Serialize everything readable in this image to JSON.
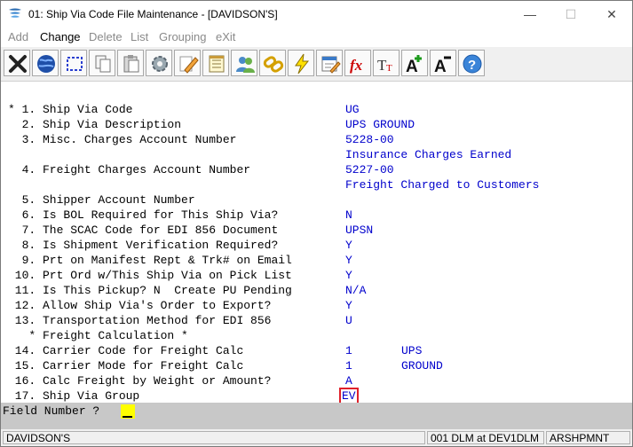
{
  "window": {
    "title": "01: Ship Via Code File Maintenance - [DAVIDSON'S]",
    "minimize": "—",
    "maximize": "☐",
    "close": "✕"
  },
  "menu": [
    {
      "label": "Add",
      "name": "menu-add",
      "active": false
    },
    {
      "label": "Change",
      "name": "menu-change",
      "active": true
    },
    {
      "label": "Delete",
      "name": "menu-delete",
      "active": false
    },
    {
      "label": "List",
      "name": "menu-list",
      "active": false
    },
    {
      "label": "Grouping",
      "name": "menu-grouping",
      "active": false
    },
    {
      "label": "eXit",
      "name": "menu-exit",
      "active": false
    }
  ],
  "toolbar": [
    "close-x-icon",
    "globe-icon",
    "select-rectangle-icon",
    "copy-icon",
    "paste-icon",
    "settings-gear-icon",
    "edit-pencil-icon",
    "notepad-icon",
    "users-icon",
    "chain-link-icon",
    "lightning-icon",
    "calendar-edit-icon",
    "function-fx-icon",
    "font-size-icon",
    "font-increase-icon",
    "font-decrease-icon",
    "help-icon"
  ],
  "fields": [
    {
      "label": "* 1. Ship Via Code",
      "values": [
        {
          "text": "UG"
        }
      ]
    },
    {
      "label": "  2. Ship Via Description",
      "values": [
        {
          "text": "UPS GROUND"
        }
      ]
    },
    {
      "label": "  3. Misc. Charges Account Number",
      "values": [
        {
          "text": "5228-00"
        }
      ]
    },
    {
      "label": "",
      "values": [
        {
          "text": "Insurance Charges Earned"
        }
      ]
    },
    {
      "label": "  4. Freight Charges Account Number",
      "values": [
        {
          "text": "5227-00"
        }
      ]
    },
    {
      "label": "",
      "values": [
        {
          "text": "Freight Charged to Customers"
        }
      ]
    },
    {
      "label": "  5. Shipper Account Number",
      "values": []
    },
    {
      "label": "  6. Is BOL Required for This Ship Via?",
      "values": [
        {
          "text": "N"
        }
      ]
    },
    {
      "label": "  7. The SCAC Code for EDI 856 Document",
      "values": [
        {
          "text": "UPSN"
        }
      ]
    },
    {
      "label": "  8. Is Shipment Verification Required?",
      "values": [
        {
          "text": "Y"
        }
      ]
    },
    {
      "label": "  9. Prt on Manifest Rept & Trk# on Email",
      "values": [
        {
          "text": "Y"
        }
      ]
    },
    {
      "label": " 10. Prt Ord w/This Ship Via on Pick List",
      "values": [
        {
          "text": "Y"
        }
      ]
    },
    {
      "label": " 11. Is This Pickup? N  Create PU Pending",
      "values": [
        {
          "text": "N/A"
        }
      ]
    },
    {
      "label": " 12. Allow Ship Via's Order to Export?",
      "values": [
        {
          "text": "Y"
        }
      ]
    },
    {
      "label": " 13. Transportation Method for EDI 856",
      "values": [
        {
          "text": "U"
        }
      ]
    },
    {
      "label": "   * Freight Calculation *",
      "values": []
    },
    {
      "label": " 14. Carrier Code for Freight Calc",
      "values": [
        {
          "text": "1"
        },
        {
          "text": "UPS",
          "col2": true
        }
      ]
    },
    {
      "label": " 15. Carrier Mode for Freight Calc",
      "values": [
        {
          "text": "1"
        },
        {
          "text": "GROUND",
          "col2": true
        }
      ]
    },
    {
      "label": " 16. Calc Freight by Weight or Amount?",
      "values": [
        {
          "text": "A"
        }
      ]
    },
    {
      "label": " 17. Ship Via Group",
      "values": [
        {
          "text": "EV",
          "highlight": true
        }
      ]
    }
  ],
  "prompt": "Field Number ?",
  "status": {
    "company": "DAVIDSON'S",
    "session": "001 DLM at DEV1DLM",
    "program": "ARSHPMNT"
  }
}
